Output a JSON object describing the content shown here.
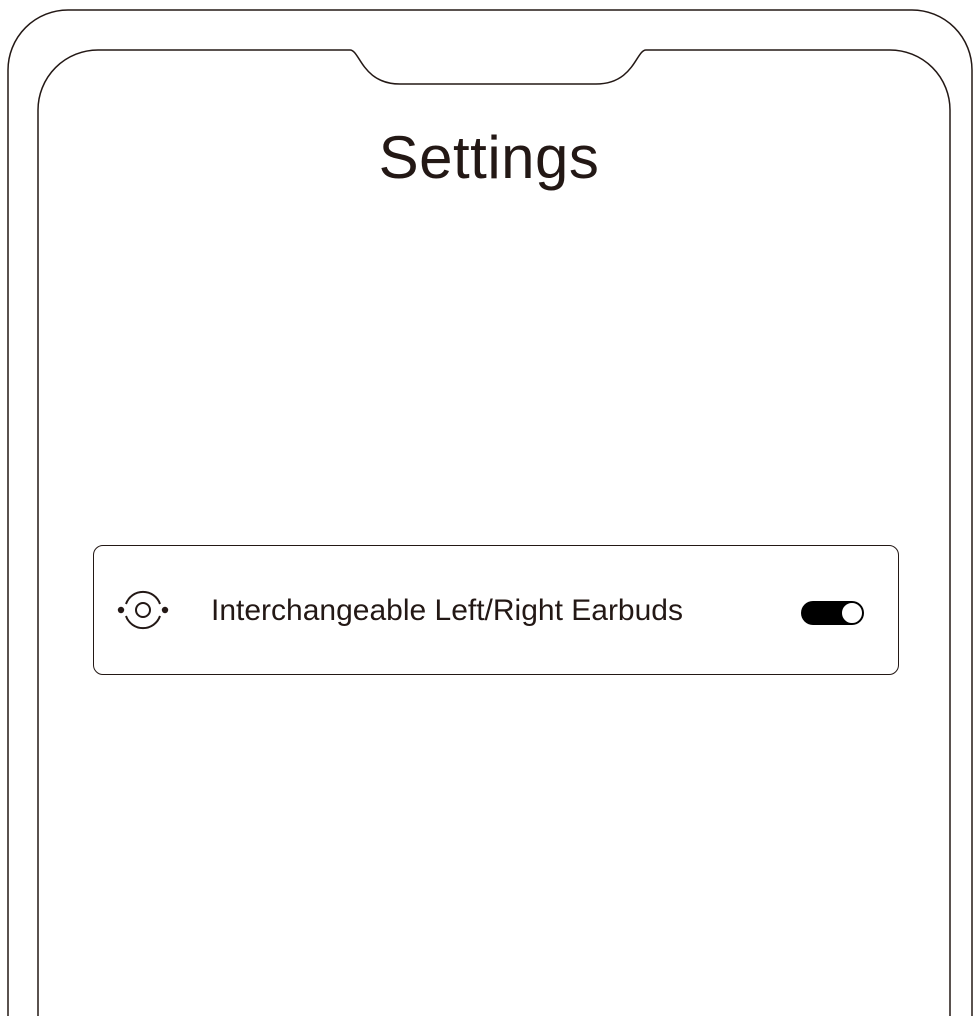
{
  "screen": {
    "title": "Settings"
  },
  "settings": {
    "items": [
      {
        "icon": "swap-circle-icon",
        "label": "Interchangeable Left/Right Earbuds",
        "enabled": true
      }
    ]
  },
  "colors": {
    "text": "#231815",
    "toggle_on": "#000000",
    "background": "#ffffff"
  }
}
